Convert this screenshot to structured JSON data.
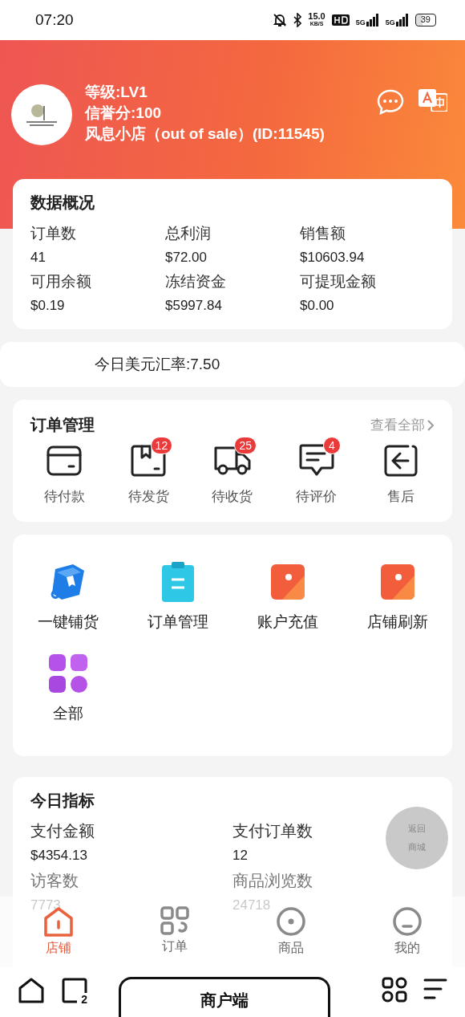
{
  "status_bar": {
    "time": "07:20",
    "speed": "15.0",
    "speed_unit": "KB/S",
    "networks": [
      "5G",
      "5G"
    ],
    "battery": "39"
  },
  "shop": {
    "level": "等级:LV1",
    "credit": "信誉分:100",
    "name": "风息小店（out of sale）(ID:11545)"
  },
  "overview": {
    "title": "数据概况",
    "stats": [
      {
        "label": "订单数",
        "value": "41"
      },
      {
        "label": "总利润",
        "value": "$72.00"
      },
      {
        "label": "销售额",
        "value": "$10603.94"
      },
      {
        "label": "可用余额",
        "value": "$0.19"
      },
      {
        "label": "冻结资金",
        "value": "$5997.84"
      },
      {
        "label": "可提现金额",
        "value": "$0.00"
      }
    ]
  },
  "exchange_rate": "今日美元汇率:7.50",
  "orders": {
    "title": "订单管理",
    "view_all": "查看全部",
    "items": [
      {
        "kind": "wallet",
        "label": "待付款"
      },
      {
        "kind": "box",
        "label": "待发货",
        "badge": "12"
      },
      {
        "kind": "truck",
        "label": "待收货",
        "badge": "25"
      },
      {
        "kind": "chat",
        "label": "待评价",
        "badge": "4"
      },
      {
        "kind": "return",
        "label": "售后"
      }
    ]
  },
  "tools": [
    {
      "kind": "package",
      "label": "一键铺货"
    },
    {
      "kind": "clipboard",
      "label": "订单管理"
    },
    {
      "kind": "card",
      "label": "账户充值"
    },
    {
      "kind": "card",
      "label": "店铺刷新"
    },
    {
      "kind": "grid",
      "label": "全部"
    }
  ],
  "metrics": {
    "title": "今日指标",
    "stats": [
      {
        "label": "支付金额",
        "value": "$4354.13"
      },
      {
        "label": "支付订单数",
        "value": "12"
      },
      {
        "label": "访客数",
        "value": "7773"
      },
      {
        "label": "商品浏览数",
        "value": "24718"
      }
    ]
  },
  "float_button": {
    "lines": [
      "返回",
      "商城"
    ]
  },
  "tab_bar": [
    {
      "kind": "shop",
      "label": "店铺",
      "selected": true
    },
    {
      "kind": "orders",
      "label": "订单",
      "selected": false
    },
    {
      "kind": "goods",
      "label": "商品",
      "selected": false
    },
    {
      "kind": "me",
      "label": "我的",
      "selected": false
    }
  ],
  "system_nav": {
    "label": "商户端",
    "badge": "2"
  }
}
